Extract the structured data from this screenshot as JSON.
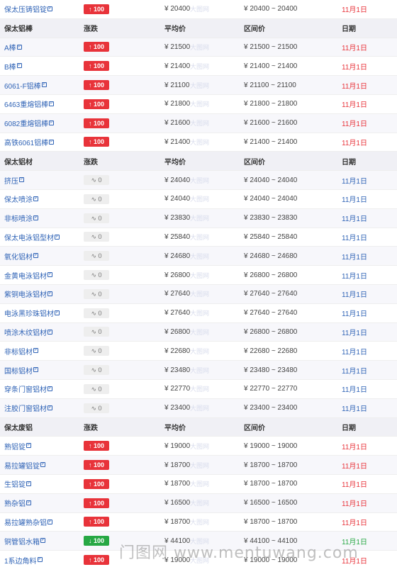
{
  "sections": [
    {
      "rows": [
        {
          "name": "保太压铸铝锭",
          "change": "100",
          "trend": "up",
          "avg": "¥ 20400",
          "range": "¥ 20400 ~ 20400",
          "date": "11月1日"
        }
      ]
    },
    {
      "header": {
        "name": "保太铝棒",
        "change": "涨跌",
        "avg": "平均价",
        "range": "区间价",
        "date": "日期"
      },
      "rows": [
        {
          "name": "A棒",
          "change": "100",
          "trend": "up",
          "avg": "¥ 21500",
          "range": "¥ 21500 ~ 21500",
          "date": "11月1日"
        },
        {
          "name": "B棒",
          "change": "100",
          "trend": "up",
          "avg": "¥ 21400",
          "range": "¥ 21400 ~ 21400",
          "date": "11月1日"
        },
        {
          "name": "6061-F铝棒",
          "change": "100",
          "trend": "up",
          "avg": "¥ 21100",
          "range": "¥ 21100 ~ 21100",
          "date": "11月1日"
        },
        {
          "name": "6463重熔铝棒",
          "change": "100",
          "trend": "up",
          "avg": "¥ 21800",
          "range": "¥ 21800 ~ 21800",
          "date": "11月1日"
        },
        {
          "name": "6082重熔铝棒",
          "change": "100",
          "trend": "up",
          "avg": "¥ 21600",
          "range": "¥ 21600 ~ 21600",
          "date": "11月1日"
        },
        {
          "name": "高铁6061铝棒",
          "change": "100",
          "trend": "up",
          "avg": "¥ 21400",
          "range": "¥ 21400 ~ 21400",
          "date": "11月1日"
        }
      ]
    },
    {
      "header": {
        "name": "保太铝材",
        "change": "涨跌",
        "avg": "平均价",
        "range": "区间价",
        "date": "日期"
      },
      "rows": [
        {
          "name": "挤压",
          "change": "0",
          "trend": "flat",
          "avg": "¥ 24040",
          "range": "¥ 24040 ~ 24040",
          "date": "11月1日"
        },
        {
          "name": "保太喷涂",
          "change": "0",
          "trend": "flat",
          "avg": "¥ 24040",
          "range": "¥ 24040 ~ 24040",
          "date": "11月1日"
        },
        {
          "name": "非标喷涂",
          "change": "0",
          "trend": "flat",
          "avg": "¥ 23830",
          "range": "¥ 23830 ~ 23830",
          "date": "11月1日"
        },
        {
          "name": "保太电泳铝型材",
          "change": "0",
          "trend": "flat",
          "avg": "¥ 25840",
          "range": "¥ 25840 ~ 25840",
          "date": "11月1日"
        },
        {
          "name": "氧化铝材",
          "change": "0",
          "trend": "flat",
          "avg": "¥ 24680",
          "range": "¥ 24680 ~ 24680",
          "date": "11月1日"
        },
        {
          "name": "金黄电泳铝材",
          "change": "0",
          "trend": "flat",
          "avg": "¥ 26800",
          "range": "¥ 26800 ~ 26800",
          "date": "11月1日"
        },
        {
          "name": "紫铜电泳铝材",
          "change": "0",
          "trend": "flat",
          "avg": "¥ 27640",
          "range": "¥ 27640 ~ 27640",
          "date": "11月1日"
        },
        {
          "name": "电泳黑珍珠铝材",
          "change": "0",
          "trend": "flat",
          "avg": "¥ 27640",
          "range": "¥ 27640 ~ 27640",
          "date": "11月1日"
        },
        {
          "name": "喷涂木纹铝材",
          "change": "0",
          "trend": "flat",
          "avg": "¥ 26800",
          "range": "¥ 26800 ~ 26800",
          "date": "11月1日"
        },
        {
          "name": "非标铝材",
          "change": "0",
          "trend": "flat",
          "avg": "¥ 22680",
          "range": "¥ 22680 ~ 22680",
          "date": "11月1日"
        },
        {
          "name": "国标铝材",
          "change": "0",
          "trend": "flat",
          "avg": "¥ 23480",
          "range": "¥ 23480 ~ 23480",
          "date": "11月1日"
        },
        {
          "name": "穿条门窗铝材",
          "change": "0",
          "trend": "flat",
          "avg": "¥ 22770",
          "range": "¥ 22770 ~ 22770",
          "date": "11月1日"
        },
        {
          "name": "注胶门窗铝材",
          "change": "0",
          "trend": "flat",
          "avg": "¥ 23400",
          "range": "¥ 23400 ~ 23400",
          "date": "11月1日"
        }
      ]
    },
    {
      "header": {
        "name": "保太废铝",
        "change": "涨跌",
        "avg": "平均价",
        "range": "区间价",
        "date": "日期"
      },
      "rows": [
        {
          "name": "熟铝锭",
          "change": "100",
          "trend": "up",
          "avg": "¥ 19000",
          "range": "¥ 19000 ~ 19000",
          "date": "11月1日"
        },
        {
          "name": "易拉罐铝锭",
          "change": "100",
          "trend": "up",
          "avg": "¥ 18700",
          "range": "¥ 18700 ~ 18700",
          "date": "11月1日"
        },
        {
          "name": "生铝锭",
          "change": "100",
          "trend": "up",
          "avg": "¥ 18700",
          "range": "¥ 18700 ~ 18700",
          "date": "11月1日"
        },
        {
          "name": "熟杂铝",
          "change": "100",
          "trend": "up",
          "avg": "¥ 16500",
          "range": "¥ 16500 ~ 16500",
          "date": "11月1日"
        },
        {
          "name": "易拉罐熟杂铝",
          "change": "100",
          "trend": "up",
          "avg": "¥ 18700",
          "range": "¥ 18700 ~ 18700",
          "date": "11月1日"
        },
        {
          "name": "铜管铝水箱",
          "change": "100",
          "trend": "down",
          "avg": "¥ 44100",
          "range": "¥ 44100 ~ 44100",
          "date": "11月1日"
        },
        {
          "name": "1系边角料",
          "change": "100",
          "trend": "up",
          "avg": "¥ 19000",
          "range": "¥ 19000 ~ 19000",
          "date": "11月1日"
        }
      ]
    }
  ],
  "icons": {
    "up": "↑",
    "down": "↓",
    "flat": "∿"
  },
  "ext_icon": "P",
  "cell_watermark": "大图网",
  "watermark": "门图网 www.mentuwang.com",
  "colors": {
    "link": "#2f63b6",
    "up": "#e8333a",
    "down": "#27a844",
    "flat_badge": "#eeeeee",
    "header_bg": "#f0f0f5"
  }
}
